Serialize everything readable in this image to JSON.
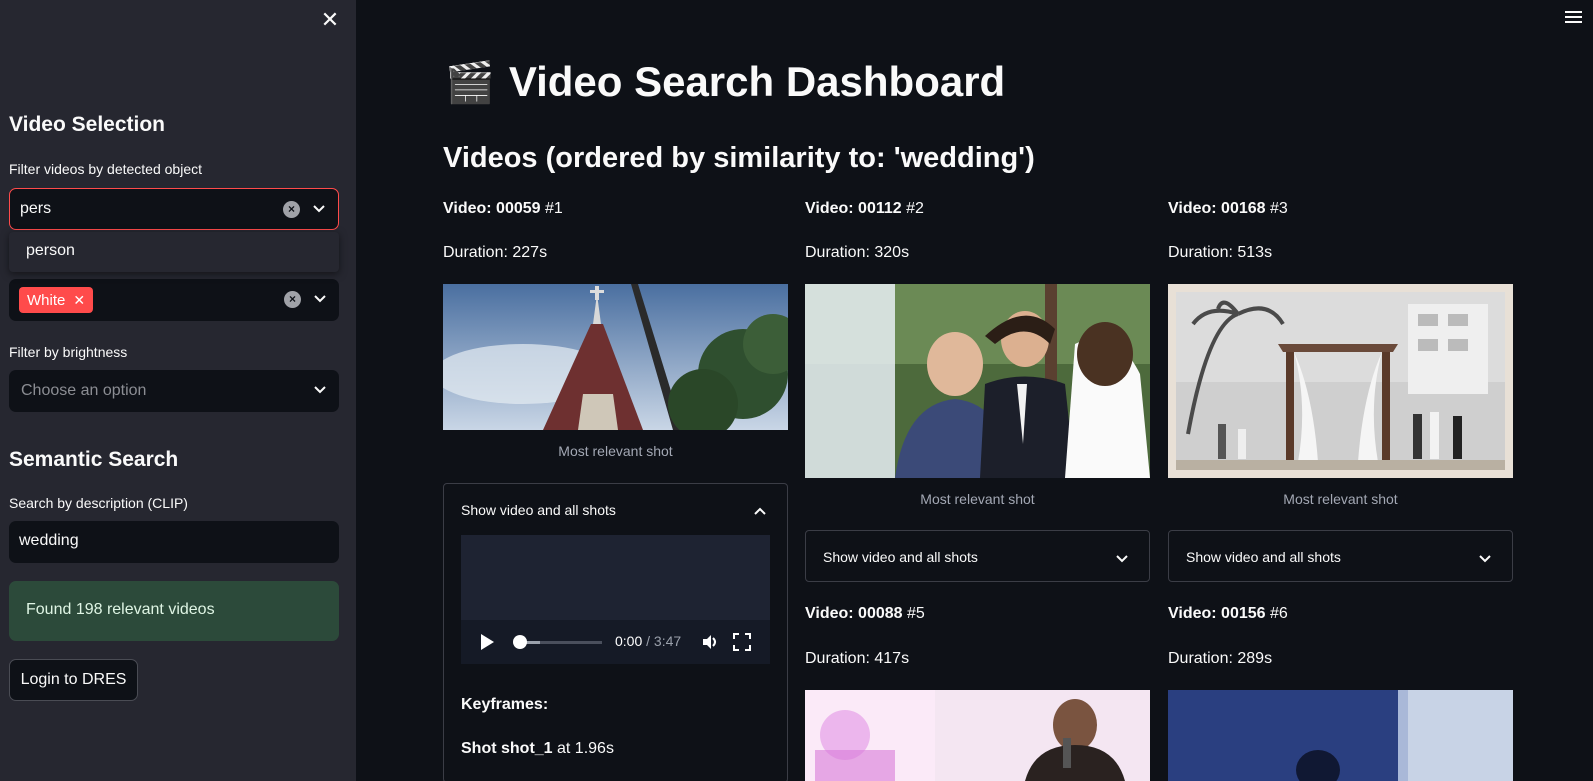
{
  "sidebar": {
    "video_selection_heading": "Video Selection",
    "object_filter_label": "Filter videos by detected object",
    "object_filter_value": "pers",
    "object_filter_option": "person",
    "color_tag": "White",
    "brightness_label": "Filter by brightness",
    "brightness_placeholder": "Choose an option",
    "semantic_heading": "Semantic Search",
    "clip_label": "Search by description (CLIP)",
    "clip_value": "wedding",
    "found_text": "Found 198 relevant videos",
    "login_label": "Login to DRES"
  },
  "main": {
    "title_icon": "🎬",
    "title": "Video Search Dashboard",
    "subtitle": "Videos (ordered by similarity to: 'wedding')",
    "caption": "Most relevant shot",
    "expander_label": "Show video and all shots",
    "videos": [
      {
        "label": "Video: 00059",
        "rank": "#1",
        "duration": "Duration: 227s"
      },
      {
        "label": "Video: 00112",
        "rank": "#2",
        "duration": "Duration: 320s"
      },
      {
        "label": "Video: 00168",
        "rank": "#3",
        "duration": "Duration: 513s"
      },
      {
        "label": "Video: 00088",
        "rank": "#5",
        "duration": "Duration: 417s"
      },
      {
        "label": "Video: 00156",
        "rank": "#6",
        "duration": "Duration: 289s"
      }
    ],
    "player": {
      "current": "0:00",
      "total": "/ 3:47",
      "progress": 0.0
    },
    "keyframes_label": "Keyframes:",
    "shot_name": "Shot shot_1",
    "shot_time": "at 1.96s"
  },
  "colors": {
    "accent": "#ff4b4b",
    "sidebar_bg": "#262730",
    "main_bg": "#0e1117",
    "success_bg": "#2c4a3a"
  }
}
